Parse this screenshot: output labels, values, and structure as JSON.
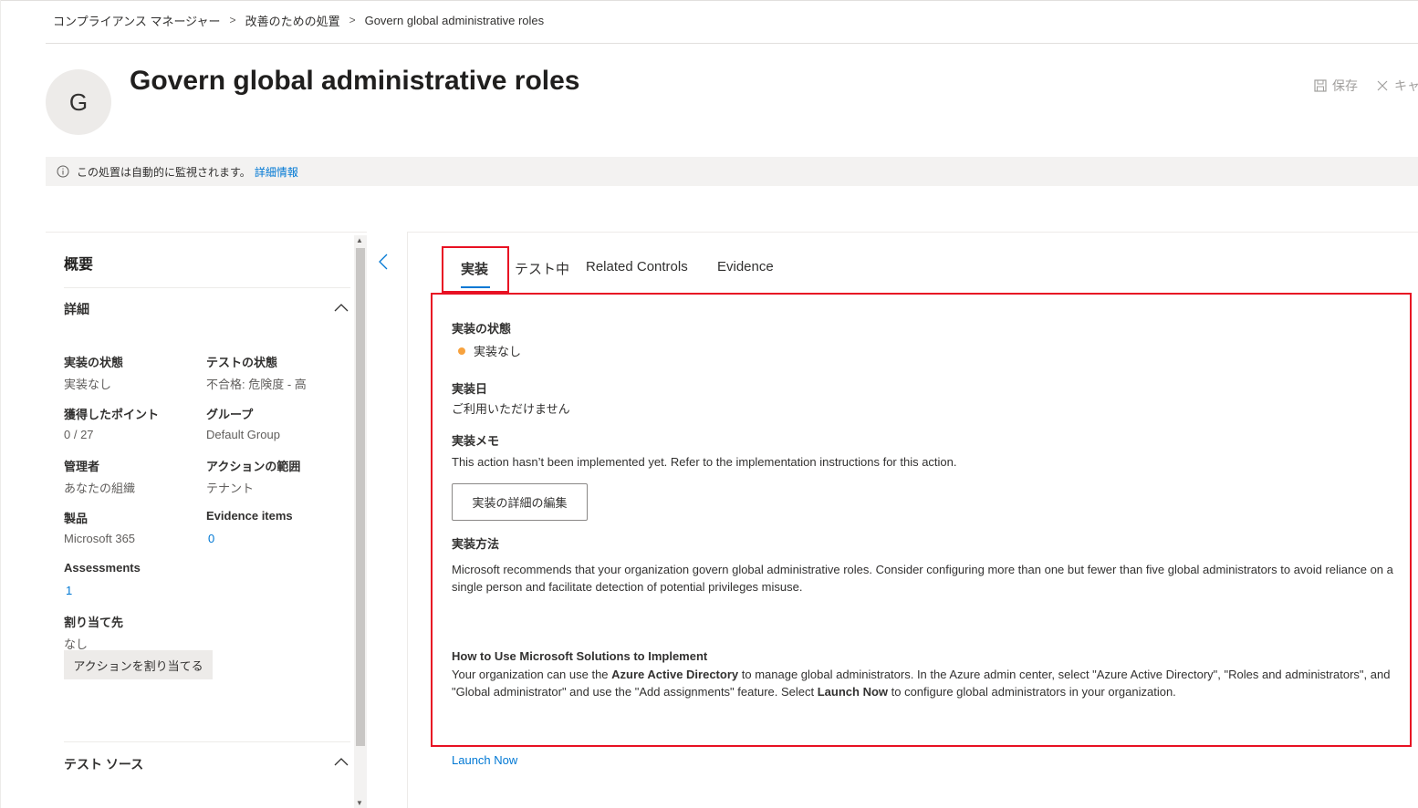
{
  "breadcrumb": {
    "items": [
      "コンプライアンス マネージャー",
      "改善のための処置",
      "Govern global administrative roles"
    ],
    "separator": ">"
  },
  "header": {
    "avatar_letter": "G",
    "title": "Govern global administrative roles",
    "save_label": "保存",
    "cancel_label": "キャ"
  },
  "info_bar": {
    "text": "この処置は自動的に監視されます。",
    "link": "詳細情報"
  },
  "sidebar": {
    "title": "概要",
    "details_heading": "詳細",
    "fields": {
      "impl_status_label": "実装の状態",
      "impl_status_value": "実装なし",
      "test_status_label": "テストの状態",
      "test_status_value": "不合格: 危険度 - 高",
      "points_label": "獲得したポイント",
      "points_value": "0 / 27",
      "group_label": "グループ",
      "group_value": "Default Group",
      "admin_label": "管理者",
      "admin_value": "あなたの組織",
      "scope_label": "アクションの範囲",
      "scope_value": "テナント",
      "product_label": "製品",
      "product_value": "Microsoft 365",
      "evidence_label": "Evidence items",
      "evidence_value": "0",
      "assessments_label": "Assessments",
      "assessments_value": "1",
      "assigned_label": "割り当て先",
      "assigned_value": "なし"
    },
    "assign_button": "アクションを割り当てる",
    "test_source_heading": "テスト ソース"
  },
  "tabs": [
    "実装",
    "テスト中",
    "Related Controls",
    "Evidence"
  ],
  "implementation": {
    "status_label": "実装の状態",
    "status_value": "実装なし",
    "status_color": "#f7a23e",
    "date_label": "実装日",
    "date_value": "ご利用いただけません",
    "notes_label": "実装メモ",
    "notes_value": "This action hasn’t been implemented yet. Refer to the implementation instructions for this action.",
    "edit_button": "実装の詳細の編集",
    "method_label": "実装方法",
    "method_text": "Microsoft recommends that your organization govern global administrative roles. Consider configuring more than one but fewer than five global administrators to avoid reliance on a single person and facilitate detection of potential privileges misuse.",
    "howto_title": "How to Use Microsoft Solutions to Implement",
    "howto_p1": "Your organization can use the ",
    "howto_b1": "Azure Active Directory",
    "howto_p2": " to manage global administrators. In the Azure admin center, select \"Azure Active Directory\", \"Roles and administrators\", and \"Global administrator\" and use the \"Add assignments\" feature. Select ",
    "howto_b2": "Launch Now",
    "howto_p3": " to configure global administrators in your organization.",
    "launch_link": "Launch Now"
  },
  "colors": {
    "accent": "#0078d4",
    "highlight": "#e81123"
  }
}
